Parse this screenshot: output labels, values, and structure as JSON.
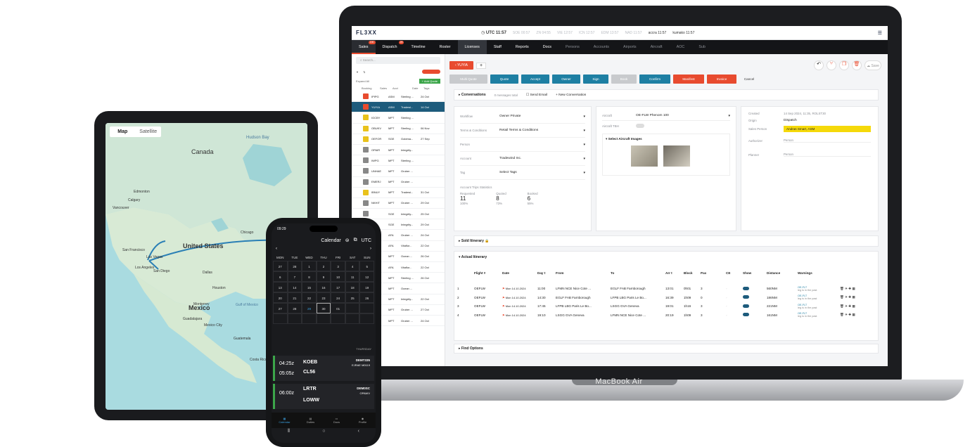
{
  "laptop": {
    "brand": "MacBook Air",
    "app": {
      "logo": "FL3XX",
      "clock": "UTC 11:57",
      "timezones": [
        "SOE 00:57",
        "ZN 04:55",
        "VIE 12:57",
        "ICN 12:57",
        "EDM 13:57",
        "NAD 11:57",
        "accra 11:57",
        "kumako 11:57"
      ],
      "nav": [
        {
          "label": "Sales",
          "badge": "190",
          "active": true
        },
        {
          "label": "Dispatch",
          "badge": "29"
        },
        {
          "label": "Timeline"
        },
        {
          "label": "Roster"
        },
        {
          "label": "Licenses",
          "highlight": true
        },
        {
          "label": "Staff"
        },
        {
          "label": "Reports"
        },
        {
          "label": "Docs"
        },
        {
          "label": "Persons",
          "dim": true
        },
        {
          "label": "Accounts",
          "dim": true
        },
        {
          "label": "Airports",
          "dim": true
        },
        {
          "label": "Aircraft",
          "dim": true
        },
        {
          "label": "AOC",
          "dim": true
        },
        {
          "label": "Sub",
          "dim": true
        }
      ],
      "search_placeholder": "Search...",
      "expand_all": "Expand All",
      "add_quote": "+ Add Quote",
      "list_headers": [
        "Booking",
        "Sales",
        "Acct",
        "Date",
        "Tags"
      ],
      "list": [
        {
          "code": "IPIPG",
          "sales": "ASM",
          "acct": "Sterling ...",
          "date": "24 Oct",
          "color": "#e84b2f"
        },
        {
          "code": "YUYIA",
          "sales": "ASM",
          "acct": "Tradewi...",
          "date": "14 Oct",
          "color": "#e84b2f",
          "selected": true
        },
        {
          "code": "IGCBY",
          "sales": "MPT",
          "acct": "Sterling ...",
          "date": "",
          "color": "#e9c21c"
        },
        {
          "code": "OBUKV",
          "sales": "MPT",
          "acct": "Sterling ...",
          "date": "06 Nov",
          "color": "#e9c21c"
        },
        {
          "code": "OEFOR",
          "sales": "SGE",
          "acct": "Goldma...",
          "date": "27 Sep",
          "color": "#e9c21c"
        },
        {
          "code": "OPAIR",
          "sales": "MPT",
          "acct": "Integrity...",
          "date": "",
          "color": "#888"
        },
        {
          "code": "IWPG",
          "sales": "MPT",
          "acct": "Sterling ...",
          "date": "",
          "color": "#888"
        },
        {
          "code": "UNHAE",
          "sales": "MPT",
          "acct": "Gruber ...",
          "date": "",
          "color": "#888"
        },
        {
          "code": "EMERJ",
          "sales": "MPT",
          "acct": "Gruber ...",
          "date": "",
          "color": "#888"
        },
        {
          "code": "IBNUY",
          "sales": "MPT",
          "acct": "Tradewi...",
          "date": "31 Oct",
          "color": "#e9c21c"
        },
        {
          "code": "NKHIT",
          "sales": "MPT",
          "acct": "Gruber ...",
          "date": "29 Oct",
          "color": "#888"
        },
        {
          "code": "",
          "sales": "SGE",
          "acct": "Integrity...",
          "date": "25 Oct",
          "color": "#888"
        },
        {
          "code": "",
          "sales": "SGE",
          "acct": "Integrity...",
          "date": "29 Oct",
          "color": "#888"
        },
        {
          "code": "",
          "sales": "AFA",
          "acct": "Gruber ...",
          "date": "24 Oct",
          "color": "#888"
        },
        {
          "code": "",
          "sales": "AFA",
          "acct": "Vitaflor...",
          "date": "22 Oct",
          "color": "#888"
        },
        {
          "code": "",
          "sales": "MPT",
          "acct": "Ocean ...",
          "date": "26 Oct",
          "color": "#888"
        },
        {
          "code": "",
          "sales": "AFA",
          "acct": "Vitaflor...",
          "date": "22 Oct",
          "color": "#888"
        },
        {
          "code": "",
          "sales": "MPT",
          "acct": "Sterling ...",
          "date": "26 Oct",
          "color": "#888"
        },
        {
          "code": "",
          "sales": "MPT",
          "acct": "Ocean ...",
          "date": "",
          "color": "#888"
        },
        {
          "code": "",
          "sales": "MPT",
          "acct": "Integrity...",
          "date": "22 Oct",
          "color": "#888"
        },
        {
          "code": "",
          "sales": "MPT",
          "acct": "Gruber ...",
          "date": "27 Oct",
          "color": "#888"
        },
        {
          "code": "",
          "sales": "MPT",
          "acct": "Gruber ...",
          "date": "24 Oct",
          "color": "#888"
        }
      ],
      "trip_tab": "YUYIA",
      "actions": [
        {
          "label": "Multi Quote",
          "color": "#c8cacd"
        },
        {
          "label": "Quote",
          "color": "#1e7fa3"
        },
        {
          "label": "Accept",
          "color": "#1e7fa3"
        },
        {
          "label": "Owner",
          "color": "#1e7fa3"
        },
        {
          "label": "Sign",
          "color": "#1e7fa3"
        },
        {
          "label": "Book",
          "color": "#c8cacd"
        },
        {
          "label": "Confirm",
          "color": "#1e7fa3"
        },
        {
          "label": "Manifest",
          "color": "#e84b2f"
        },
        {
          "label": "Invoice",
          "color": "#e84b2f"
        }
      ],
      "cancel": "Cancel",
      "conversations": "Conversations",
      "messages_total": "0 messages total",
      "send_email": "Send Email",
      "new_conversation": "+ New Conversation",
      "form": [
        {
          "label": "Workflow",
          "value": "Owner Private"
        },
        {
          "label": "Terms & Conditions",
          "value": "Retail Terms & Conditions"
        },
        {
          "label": "Person",
          "value": ""
        },
        {
          "label": "Account",
          "value": "Tradewind Inc."
        },
        {
          "label": "Tag",
          "value": "Select Tags"
        }
      ],
      "stats_title": "Account Trips Statistics",
      "stats": [
        {
          "label": "Requested",
          "value": "11",
          "sub": "100%"
        },
        {
          "label": "Quoted",
          "value": "8",
          "sub": "73%"
        },
        {
          "label": "Booked",
          "value": "6",
          "sub": "55%"
        }
      ],
      "aircraft_label": "Aircraft",
      "aircraft": "OE-FLW Phenom 100",
      "aircraft_tbh": "Aircraft TBH",
      "select_images": "Select Aircraft Images",
      "created_label": "Created",
      "created": "14 Sep 2024, 11:35, ROLST30",
      "origin_label": "Origin",
      "origin": "Dispatch",
      "salesperson_label": "Sales Person",
      "salesperson": "Andras Smart, ASM",
      "authorizer_label": "Authorizer",
      "authorizer": "Person",
      "planner_label": "Planner",
      "planner": "Person",
      "sold_itinerary": "Sold Itinerary",
      "actual_itinerary": "Actual Itinerary",
      "find_options": "Find Options",
      "itin_headers": [
        "Flight #",
        "Date",
        "Day t",
        "From",
        "To",
        "Arr t",
        "Block",
        "Pax",
        "CE",
        "Show",
        "Distance",
        "Warnings"
      ],
      "itin": [
        {
          "n": "1",
          "flt": "OEFLW",
          "date": "Mon 14.10.2024",
          "dep": "11:00",
          "from": "LFMN NCE Nice Cote ...",
          "to": "EGLF FAB Farnborough",
          "arr": "13:01",
          "block": "0h01",
          "pax": "3",
          "dist": "560NM"
        },
        {
          "n": "2",
          "flt": "OEFLW",
          "date": "Mon 14.10.2024",
          "dep": "14:30",
          "from": "EGLF FAB Farnborough",
          "to": "LFPB LBG Paris Le Bo...",
          "arr": "16:39",
          "block": "1h09",
          "pax": "0",
          "dist": "186NM"
        },
        {
          "n": "3",
          "flt": "OEFLW",
          "date": "Mon 14.10.2024",
          "dep": "17:45",
          "from": "LFPB LBG Paris Le Bo...",
          "to": "LSGG GVA Geneva",
          "arr": "19:01",
          "block": "1h16",
          "pax": "3",
          "dist": "221NM"
        },
        {
          "n": "4",
          "flt": "OEFLW",
          "date": "Mon 14.10.2024",
          "dep": "19:10",
          "from": "LSGG GVA Geneva",
          "to": "LFMN NCE Nice Cote ...",
          "arr": "20:19",
          "block": "1h09",
          "pax": "3",
          "dist": "161NM"
        }
      ],
      "warning_text": "OE-FLT",
      "warning_sub": "leg is in the past"
    }
  },
  "tablet": {
    "map_tab": "Map",
    "satellite_tab": "Satellite",
    "labels": [
      {
        "text": "Canada",
        "size": 9
      },
      {
        "text": "United States",
        "size": 9
      },
      {
        "text": "Mexico",
        "size": 9
      },
      {
        "text": "Hudson Bay",
        "size": 6
      },
      {
        "text": "Chicago",
        "size": 5
      },
      {
        "text": "San Francisco",
        "size": 5
      },
      {
        "text": "Las Vegas",
        "size": 5
      },
      {
        "text": "Los Angeles",
        "size": 5
      },
      {
        "text": "San Diego",
        "size": 5
      },
      {
        "text": "Dallas",
        "size": 5
      },
      {
        "text": "Houston",
        "size": 5
      },
      {
        "text": "Guatemala",
        "size": 5
      },
      {
        "text": "Costa Rica",
        "size": 5
      },
      {
        "text": "Gulf of Mexico",
        "size": 5
      },
      {
        "text": "Edmonton",
        "size": 5
      },
      {
        "text": "Calgary",
        "size": 5
      },
      {
        "text": "Vancouver",
        "size": 5
      },
      {
        "text": "Monterrey",
        "size": 5
      },
      {
        "text": "Guadalajara",
        "size": 5
      },
      {
        "text": "Mexico City",
        "size": 5
      }
    ]
  },
  "phone": {
    "time": "09:29",
    "title": "Calendar",
    "utc": "UTC",
    "days": [
      "MON",
      "TUE",
      "WED",
      "THU",
      "FRI",
      "SAT",
      "SUN"
    ],
    "weeks": [
      [
        "27",
        "28",
        "1",
        "2",
        "3",
        "4",
        "5"
      ],
      [
        "6",
        "7",
        "8",
        "9",
        "10",
        "11",
        "12"
      ],
      [
        "13",
        "14",
        "15",
        "16",
        "17",
        "18",
        "19"
      ],
      [
        "20",
        "21",
        "22",
        "23",
        "24",
        "25",
        "26"
      ],
      [
        "27",
        "28",
        "29",
        "30",
        "01",
        "",
        ""
      ],
      [
        "",
        "",
        "",
        "",
        "",
        "",
        ""
      ]
    ],
    "day_label": "THURSDAY",
    "flights": [
      {
        "from": "KOEB",
        "to": "CL56",
        "t1": "04:25z",
        "t2": "05:05z",
        "reg": "DEMT335",
        "info": "EJRAE M0119"
      },
      {
        "from": "LRTR",
        "to": "LOWW",
        "t1": "06:00z",
        "t2": "",
        "reg": "DEM0SC",
        "info": "OPAWV"
      }
    ],
    "nav": [
      "Calendar",
      "Duties",
      "Docs",
      "Profile"
    ]
  }
}
